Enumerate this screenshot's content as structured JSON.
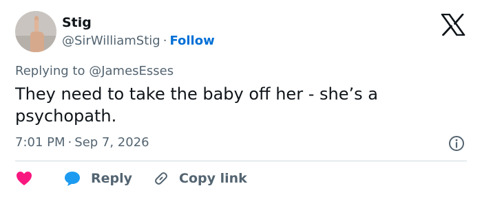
{
  "author": {
    "name": "Stig",
    "handle": "@SirWilliamStig",
    "separator": "·",
    "follow_label": "Follow"
  },
  "reply_context": {
    "prefix": "Replying to",
    "mention": "@JamesEsses"
  },
  "tweet": {
    "text": "They need to take the baby off her - she’s a psychopath."
  },
  "meta": {
    "time": "7:01 PM",
    "separator": "·",
    "date": "Sep 7, 2026"
  },
  "actions": {
    "reply_label": "Reply",
    "copy_link_label": "Copy link"
  },
  "colors": {
    "like": "#f91880",
    "reply": "#1d9bf0",
    "link": "#006fd6",
    "secondary_text": "#536471"
  },
  "icons": {
    "brand": "x-logo-icon",
    "info": "info-icon",
    "like": "heart-icon",
    "reply": "speech-bubble-icon",
    "copy_link": "link-icon"
  }
}
